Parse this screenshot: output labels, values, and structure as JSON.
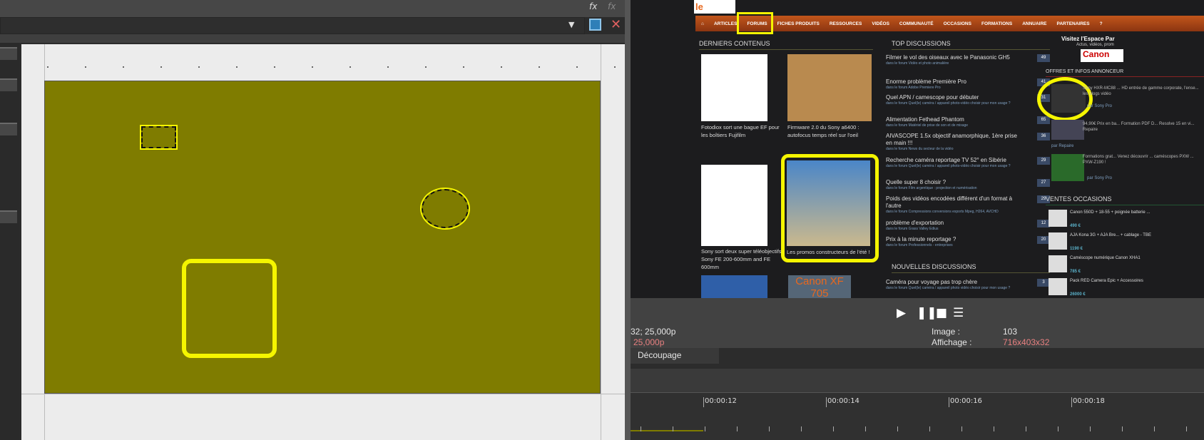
{
  "editor": {
    "fx_icon": "fx-icon",
    "fx_remove_icon": "fx-remove-icon",
    "save_icon": "save-icon",
    "close_icon": "close-icon",
    "dropdown_value": ""
  },
  "website": {
    "logo": "le repaire",
    "nav": [
      "ARTICLES",
      "FORUMS",
      "FICHES PRODUITS",
      "RESSOURCES",
      "VIDÉOS",
      "COMMUNAUTÉ",
      "OCCASIONS",
      "FORMATIONS",
      "ANNUAIRE",
      "PARTENAIRES"
    ],
    "latest_title": "DERNIERS CONTENUS",
    "latest": [
      "Fotodiox sort une bague EF pour les boîtiers Fujifilm",
      "Firmware 2.0 du Sony a6400 : autofocus temps réel sur l'oeil",
      "Sony sort deux super téléobjectifs Sony FE 200-600mm and FE 600mm",
      "Les promos constructeurs de l'été !"
    ],
    "latest_more": "Canon XF 705",
    "top_title": "TOP DISCUSSIONS",
    "top": [
      {
        "t": "Filmer le vol des oiseaux avec le Panasonic GH5",
        "f": "dans le forum Vidéo et photo animalière",
        "n": "49"
      },
      {
        "t": "Enorme problème Première Pro",
        "f": "dans le forum Adobe Premiere Pro",
        "n": "41"
      },
      {
        "t": "Quel APN / camescope pour débuter",
        "f": "dans le forum Quel(le) caméra / appareil photo-vidéo choisir pour mon usage ?",
        "n": "31"
      },
      {
        "t": "Alimentation Fethead Phantom",
        "f": "dans le forum Matériel de prise de son et de mixage",
        "n": "65"
      },
      {
        "t": "AIVASCOPE 1.5x objectif anamorphique, 1ère prise en main !!!",
        "f": "dans le forum News du secteur de la vidéo",
        "n": "36"
      },
      {
        "t": "Recherche caméra reportage TV 52° en Sibérie",
        "f": "dans le forum Quel(le) caméra / appareil photo-vidéo choisir pour mon usage ?",
        "n": "29"
      },
      {
        "t": "Quelle super 8 choisir ?",
        "f": "dans le forum Film argentique : projection et numérisation",
        "n": "27"
      },
      {
        "t": "Poids des vidéos encodées différent d'un format à l'autre",
        "f": "dans le forum Compressions conversions exports Mpeg, H264, AVCHD",
        "n": "29"
      },
      {
        "t": "problème d'exportation",
        "f": "dans le forum Grass Valley Edius",
        "n": "12"
      },
      {
        "t": "Prix à la minute reportage ?",
        "f": "dans le forum Professionnels - entreprises",
        "n": "20"
      }
    ],
    "new_title": "NOUVELLES DISCUSSIONS",
    "new": [
      {
        "t": "Caméra pour voyage pas trop chère",
        "f": "dans le forum Quel(le) caméra / appareil photo vidéo choisir pour mon usage ?",
        "n": "3"
      }
    ],
    "espace": "Visitez l'Espace Par",
    "espace_sub": "Actus, vidéos, prom",
    "canon": "Canon",
    "offers_title": "OFFRES ET INFOS ANNONCEUR",
    "offers": [
      {
        "t": "Sony HXR-MC88 ... HD entrée de gamme corporate, l'ense... les blogs vidéo",
        "by": "par Sony Pro"
      },
      {
        "t": "94,90€ Prix en ba... Formation PDF D... Resolve 15 en vi... Repaire",
        "by": "par Repaire"
      },
      {
        "t": "Formations grat... Venez découvrir ... caméscopes PXW ... PXW-Z190 !",
        "by": "par Sony Pro"
      }
    ],
    "sales_title": "VENTES OCCASIONS",
    "sales": [
      {
        "t": "Canon 550D + 18-55 + poignée batterie ...",
        "p": "490 €"
      },
      {
        "t": "AJA Kona 3G + AJA Bre... + cablage - TBE",
        "p": "1190 €"
      },
      {
        "t": "Caméscope numérique Canon XHA1",
        "p": "785 €"
      },
      {
        "t": "Pack RED Camera Epic + Accessoires",
        "p": "26000 €"
      }
    ]
  },
  "player": {
    "play_icon": "play-icon",
    "pause_icon": "pause-icon",
    "stop_icon": "stop-icon",
    "menu_icon": "menu-icon",
    "left_line1": "32; 25,000p",
    "left_line2": "25,000p",
    "image_label": "Image :",
    "image_value": "103",
    "display_label": "Affichage :",
    "display_value": "716x403x32",
    "value_color": "#e88080"
  },
  "tabs": {
    "cut": "Découpage"
  },
  "timeline": {
    "labels": [
      "00:00:12",
      "00:00:14",
      "00:00:16",
      "00:00:18"
    ]
  },
  "colors": {
    "canvas": "#7f7c00",
    "selection": "#f5f500",
    "nav": "#b04a17"
  }
}
